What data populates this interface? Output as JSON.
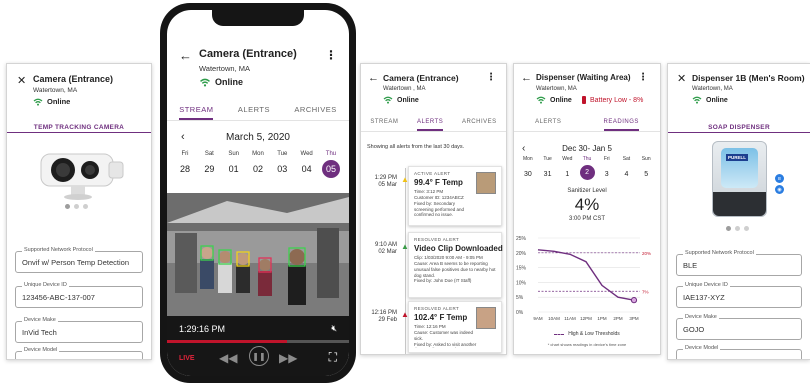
{
  "colors": {
    "accent": "#6f2f7f",
    "online": "#2e9c4a",
    "battery": "#c0142b",
    "live": "#c0142b"
  },
  "screen1": {
    "title": "Camera (Entrance)",
    "location": "Watertown, MA",
    "status": "Online",
    "section": "TEMP TRACKING CAMERA",
    "fields": [
      {
        "label": "Supported Network Protocol",
        "value": "Onvif w/ Person Temp Detection"
      },
      {
        "label": "Unique Device ID",
        "value": "123456-ABC-137-007"
      },
      {
        "label": "Device Make",
        "value": "InVid Tech"
      },
      {
        "label": "Device Model",
        "value": ""
      }
    ]
  },
  "phone": {
    "title": "Camera (Entrance)",
    "location": "Watertown, MA",
    "status": "Online",
    "tabs": [
      "STREAM",
      "ALERTS",
      "ARCHIVES"
    ],
    "month": "March 5, 2020",
    "days": [
      {
        "name": "Fri",
        "date": "28"
      },
      {
        "name": "Sat",
        "date": "29"
      },
      {
        "name": "Sun",
        "date": "01"
      },
      {
        "name": "Mon",
        "date": "02"
      },
      {
        "name": "Tue",
        "date": "03"
      },
      {
        "name": "Wed",
        "date": "04"
      },
      {
        "name": "Thu",
        "date": "05"
      }
    ],
    "timestamp": "1:29:16 PM",
    "live": "LIVE"
  },
  "alerts": {
    "title": "Camera (Entrance)",
    "location": "Watertown , MA",
    "status": "Online",
    "tabs": [
      "STREAM",
      "ALERTS",
      "ARCHIVES"
    ],
    "notice": "Showing all alerts from the last 30 days.",
    "items": [
      {
        "time": "1:29 PM",
        "date": "05 Mar",
        "kind": "ACTIVE ALERT",
        "title": "99.4° F Temp",
        "desc": "Time: 3:12 PM\nCustomer ID: 1234ABCZ\nFixed by: Secondary screening performed and confirmed no issue."
      },
      {
        "time": "9:10 AM",
        "date": "02 Mar",
        "kind": "RESOLVED ALERT",
        "title": "Video Clip Downloaded",
        "desc": "Clip: 1/03/2020 9:00 AM - 9:05 PM\nCause: Area B seems to be reporting unusual false positives due to nearby hot dog stand.\nFixed by: John Doe (IT Staff)"
      },
      {
        "time": "12:16 PM",
        "date": "29 Feb",
        "kind": "RESOLVED ALERT",
        "title": "102.4° F Temp",
        "desc": "Time: 12:16 PM\nCause: Customer was indeed sick.\nFixed by: Asked to visit another day. Family accepted group pass."
      }
    ]
  },
  "dispenser": {
    "title": "Dispenser (Waiting Area)",
    "location": "Watertown, MA",
    "status": "Online",
    "battery": "Battery Low - 8%",
    "tabs": [
      "ALERTS",
      "READINGS"
    ],
    "range": "Dec 30- Jan 5",
    "days": [
      {
        "name": "Mon",
        "date": "30"
      },
      {
        "name": "Tue",
        "date": "31"
      },
      {
        "name": "Wed",
        "date": "1"
      },
      {
        "name": "Thu",
        "date": "2"
      },
      {
        "name": "Fri",
        "date": "3"
      },
      {
        "name": "Sat",
        "date": "4"
      },
      {
        "name": "Sun",
        "date": "5"
      }
    ],
    "reading_label": "Sanitizer Level",
    "reading_value": "4%",
    "reading_time": "3:00 PM CST",
    "legend": "High & Low Thresholds",
    "footnote": "* chart shows readings in device's time zone"
  },
  "chart_data": {
    "type": "line",
    "x": [
      "9AM",
      "10AM",
      "11AM",
      "12PM",
      "1PM",
      "2PM",
      "3PM"
    ],
    "series": [
      {
        "values": [
          21,
          20.5,
          19.5,
          17,
          9,
          5,
          4
        ]
      }
    ],
    "thresholds": [
      {
        "value": 20,
        "label": "20%"
      },
      {
        "value": 7,
        "label": "7%"
      }
    ],
    "yticks": [
      "25%",
      "20%",
      "15%",
      "10%",
      "5%",
      "0%"
    ],
    "ylim": [
      0,
      25
    ]
  },
  "screen5": {
    "title": "Dispenser 1B (Men's Room)",
    "location": "Watertown, MA",
    "status": "Online",
    "section": "SOAP DISPENSER",
    "brand": "PURELL",
    "fields": [
      {
        "label": "Supported Network Protocol",
        "value": "BLE"
      },
      {
        "label": "Unique Device ID",
        "value": "IAE137-XYZ"
      },
      {
        "label": "Device Make",
        "value": "GOJO"
      },
      {
        "label": "Device Model",
        "value": ""
      }
    ]
  }
}
